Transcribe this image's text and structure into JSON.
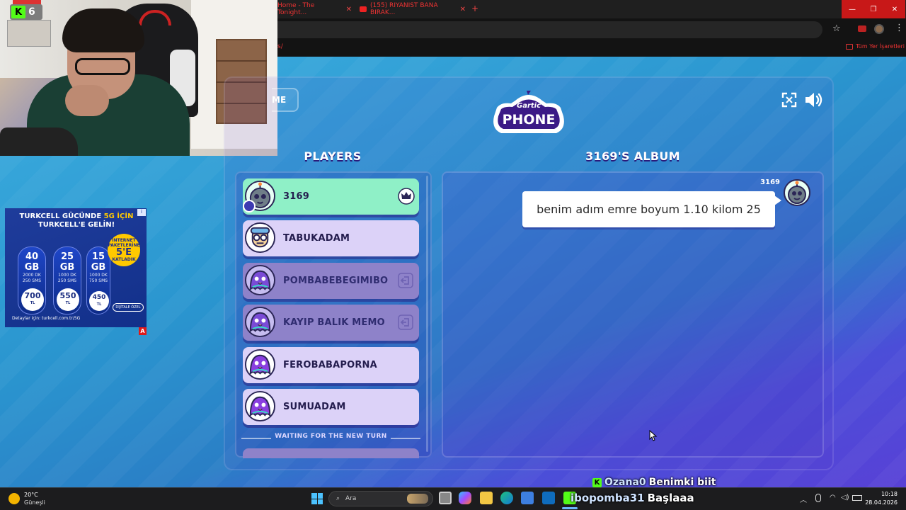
{
  "browser": {
    "tabs": [
      {
        "label": "Home - The Tonight..."
      },
      {
        "label": "(155) RIYANIST BANA BIRAK..."
      }
    ],
    "bookmarks_label": "Tüm Yer İşaretleri",
    "bookmarks_left": "s/"
  },
  "webcam": {
    "viewer_count": "6"
  },
  "ad": {
    "title_line1_a": "TURKCELL GÜCÜNDE",
    "title_line1_b": "5G İÇİN",
    "title_line2": "TURKCELL'E GELİN!",
    "packs": [
      {
        "gb": "40 GB",
        "details": "2000 DK 250 SMS",
        "price": "700",
        "unit": "TL"
      },
      {
        "gb": "25 GB",
        "details": "1000 DK 250 SMS",
        "price": "550",
        "unit": "TL"
      },
      {
        "gb": "15 GB",
        "details": "1000 DK 750 SMS",
        "price": "450",
        "unit": "TL"
      }
    ],
    "badge_top": "İNTERNET PAKETLERİNE",
    "badge_big": "5'E",
    "badge_bottom": "KATLADIK",
    "special": "DİJİTALE ÖZEL",
    "footer": "Detaylar için: turkcell.com.tr/5G",
    "corner": "A"
  },
  "game": {
    "home_label": "ME",
    "players_heading": "PLAYERS",
    "album_heading": "3169'S ALBUM",
    "players": [
      {
        "name": "3169",
        "state": "host"
      },
      {
        "name": "TABUKADAM",
        "state": "normal"
      },
      {
        "name": "POMBABEBEGIMIBO",
        "state": "away"
      },
      {
        "name": "KAYIP BALIK MEMO",
        "state": "away"
      },
      {
        "name": "FEROBABAPORNA",
        "state": "normal"
      },
      {
        "name": "SUMUADAM",
        "state": "normal"
      }
    ],
    "waiting_label": "WAITING FOR THE NEW TURN",
    "message": {
      "author": "3169",
      "text": "benim adım emre boyum 1.10 kilom 25"
    }
  },
  "stream_chat": [
    {
      "user": "Ozana0",
      "text": "Benimki biit"
    },
    {
      "user": "ibopomba31",
      "text": "Başlaaa"
    }
  ],
  "taskbar": {
    "weather_temp": "20°C",
    "weather_desc": "Güneşli",
    "search_placeholder": "Ara",
    "time": "10:18",
    "date": "28.04.2026"
  }
}
